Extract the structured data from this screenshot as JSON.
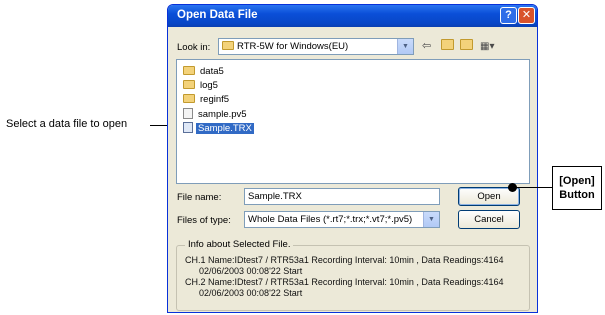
{
  "callouts": {
    "left": "Select a data file to open",
    "right_line1": "[Open]",
    "right_line2": "Button"
  },
  "dialog": {
    "title": "Open Data File",
    "help_glyph": "?",
    "close_glyph": "✕",
    "look_in_label": "Look in:",
    "look_in_value": "RTR-5W for Windows(EU)",
    "files": [
      {
        "name": "data5",
        "type": "folder"
      },
      {
        "name": "log5",
        "type": "folder"
      },
      {
        "name": "reginf5",
        "type": "folder"
      },
      {
        "name": "sample.pv5",
        "type": "file"
      },
      {
        "name": "Sample.TRX",
        "type": "trx",
        "selected": true
      }
    ],
    "file_name_label": "File name:",
    "file_name_value": "Sample.TRX",
    "files_of_type_label": "Files of type:",
    "files_of_type_value": "Whole Data Files (*.rt7;*.trx;*.vt7;*.pv5)",
    "open_label": "Open",
    "cancel_label": "Cancel",
    "info_title": "Info about Selected File.",
    "info": [
      {
        "line1": "CH.1 Name:IDtest7  / RTR53a1    Recording Interval: 10min , Data Readings:4164",
        "line2": "02/06/2003 00:08'22 Start"
      },
      {
        "line1": "CH.2 Name:IDtest7  / RTR53a1    Recording Interval: 10min , Data Readings:4164",
        "line2": "02/06/2003 00:08'22 Start"
      }
    ]
  },
  "colors": {
    "titlebar": "#0a4fd8",
    "selection": "#316ac5",
    "dialog_bg": "#ece9d8"
  },
  "icons": [
    "help-icon",
    "close-icon",
    "folder-icon",
    "back-icon",
    "up-folder-icon",
    "new-folder-icon",
    "views-icon",
    "dropdown-icon"
  ]
}
